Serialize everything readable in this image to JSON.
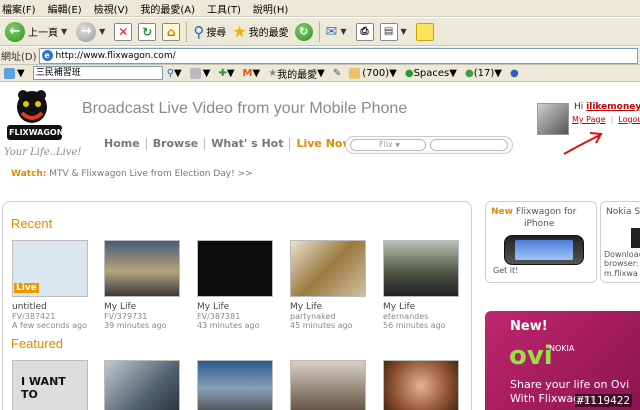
{
  "menubar": {
    "items": [
      "檔案(F)",
      "編輯(E)",
      "檢視(V)",
      "我的最愛(A)",
      "工具(T)",
      "說明(H)"
    ]
  },
  "toolbar": {
    "back_label": "上一頁",
    "search_label": "搜尋",
    "favorites_label": "我的最愛"
  },
  "addressbar": {
    "label": "網址(D)",
    "url": "http://www.flixwagon.com/"
  },
  "searchbar": {
    "query": "三民補習班",
    "favorites_label": "我的最愛",
    "mail_count": "(700)",
    "spaces_label": "Spaces",
    "msn_count": "(17)"
  },
  "site": {
    "brand": "FLIXWAGON",
    "slogan": "Your Life..Live!",
    "tagline": "Broadcast Live Video from your Mobile Phone",
    "nav": [
      "Home",
      "Browse",
      "What' s Hot",
      "Live Now"
    ],
    "search_select": "Flix",
    "watch_label": "Watch:",
    "watch_text": "MTV & Flixwagon Live from Election Day! >>",
    "user": {
      "greeting": "Hi",
      "name": "ilikemoney",
      "my_page": "My Page",
      "logout": "Logout"
    },
    "recent_title": "Recent",
    "featured_title": "Featured",
    "recent": [
      {
        "title": "untitled",
        "user": "FV/387421",
        "time": "A few seconds ago",
        "badge": "Live"
      },
      {
        "title": "My Life",
        "user": "FV/379731",
        "time": "39 minutes ago"
      },
      {
        "title": "My Life",
        "user": "FV/387381",
        "time": "43 minutes ago"
      },
      {
        "title": "My Life",
        "user": "partynaked",
        "time": "45 minutes ago"
      },
      {
        "title": "My Life",
        "user": "eternandes",
        "time": "56 minutes ago"
      }
    ],
    "featured": [
      {
        "text": "I WANT TO"
      },
      {
        "text": ""
      },
      {
        "text": ""
      },
      {
        "text": ""
      },
      {
        "text": ""
      }
    ],
    "promo_iphone": {
      "new": "New",
      "title1": "Flixwagon for",
      "title2": "iPhone",
      "cta": "Get it!"
    },
    "promo_nokia": {
      "title": "Nokia S",
      "line1": "Downloac",
      "line2": "browser:",
      "line3": "m.flixwa"
    },
    "ovi": {
      "new": "New!",
      "brand": "ovi",
      "nokia": "NOKIA",
      "line1": "Share your life on Ovi",
      "line2": "With Flixwagon"
    },
    "watermark": "#1119422"
  }
}
